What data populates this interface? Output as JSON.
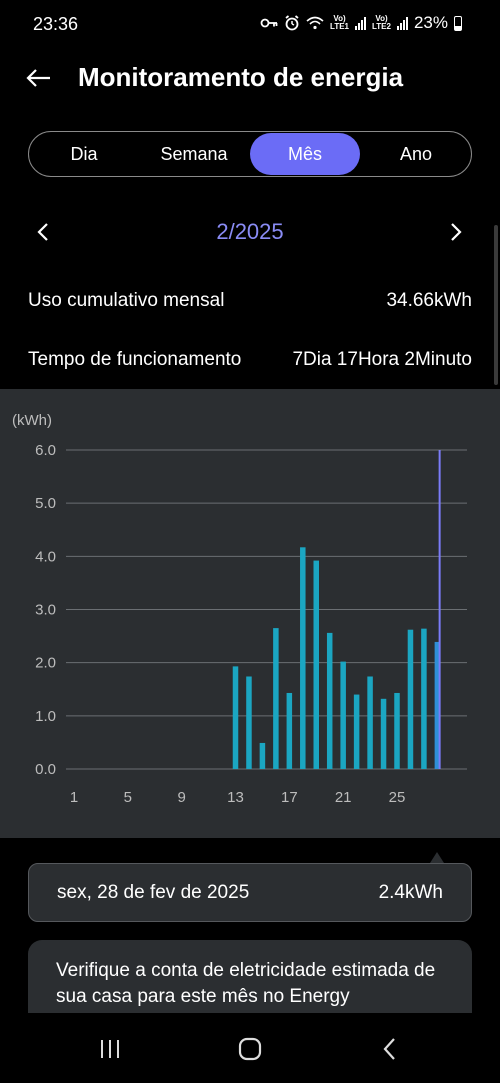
{
  "status_bar": {
    "time": "23:36",
    "battery": "23%",
    "net1": "Vo)\nLTE1",
    "net2": "Vo)\nLTE2"
  },
  "header": {
    "title": "Monitoramento de energia",
    "back_icon": "back-arrow-icon"
  },
  "tabs": [
    {
      "label": "Dia",
      "active": false
    },
    {
      "label": "Semana",
      "active": false
    },
    {
      "label": "Mês",
      "active": true
    },
    {
      "label": "Ano",
      "active": false
    }
  ],
  "period": {
    "label": "2/2025"
  },
  "summary": {
    "usage_label": "Uso cumulativo mensal",
    "usage_value": "34.66kWh",
    "runtime_label": "Tempo de funcionamento",
    "runtime_value": "7Dia 17Hora 2Minuto"
  },
  "colors": {
    "accent": "#6b6cf6",
    "bar": "#1ba6c2",
    "bar_selected": "#2f8fd6",
    "panel": "#2b2e31",
    "period_text": "#8a8cf5"
  },
  "chart_data": {
    "type": "bar",
    "unit_label": "(kWh)",
    "ylim": [
      0,
      6
    ],
    "y_ticks": [
      "0.0",
      "1.0",
      "2.0",
      "3.0",
      "4.0",
      "5.0",
      "6.0"
    ],
    "x_ticks": [
      "1",
      "5",
      "9",
      "13",
      "17",
      "21",
      "25"
    ],
    "x_tick_days": [
      1,
      5,
      9,
      13,
      17,
      21,
      25
    ],
    "x": [
      13,
      14,
      15,
      16,
      17,
      18,
      19,
      20,
      21,
      22,
      23,
      24,
      25,
      26,
      27,
      28
    ],
    "values": [
      1.93,
      1.74,
      0.49,
      2.65,
      1.43,
      4.17,
      3.92,
      2.56,
      2.02,
      1.4,
      1.74,
      1.32,
      1.43,
      2.62,
      2.64,
      2.39
    ],
    "days_in_month": 28,
    "selected_day": 28,
    "grid": true
  },
  "tooltip": {
    "date": "sex, 28 de fev de 2025",
    "value": "2.4kWh"
  },
  "promo": {
    "text": "Verifique a conta de eletricidade estimada de sua casa para este mês no Energy"
  },
  "nav": {
    "recents": "recents-icon",
    "home": "home-icon",
    "back": "back-icon"
  }
}
